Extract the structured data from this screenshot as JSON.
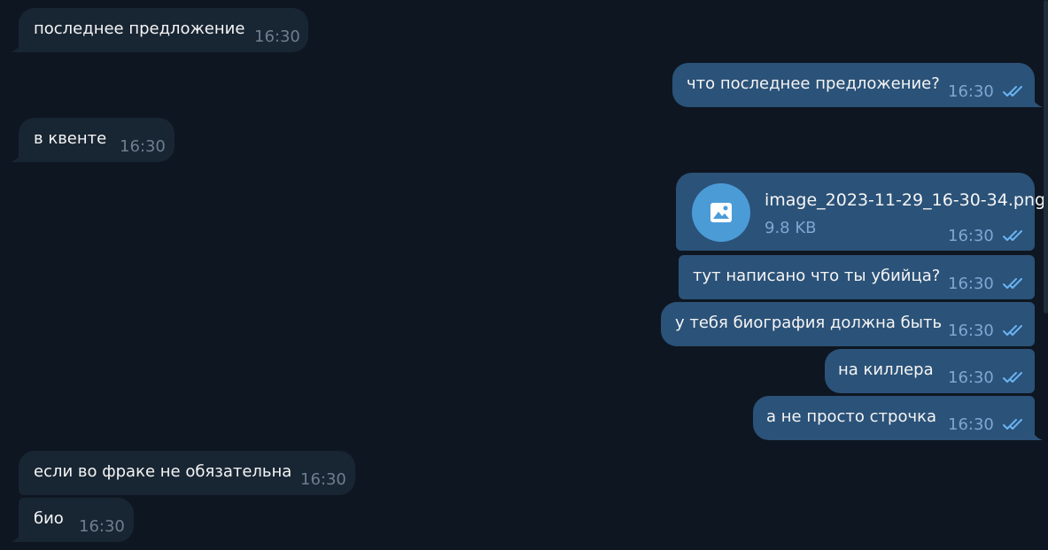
{
  "messages": [
    {
      "text": "последнее предложение",
      "time": "16:30"
    },
    {
      "text": "что последнее предложение?",
      "time": "16:30"
    },
    {
      "text": "в квенте",
      "time": "16:30"
    },
    {
      "file_name": "image_2023-11-29_16-30-34.png",
      "file_size": "9.8 KB",
      "time": "16:30",
      "icon": "image-icon"
    },
    {
      "text": "тут написано что ты убийца?",
      "time": "16:30"
    },
    {
      "text": "у тебя биография должна быть",
      "time": "16:30"
    },
    {
      "text": "на киллера",
      "time": "16:30"
    },
    {
      "text": "а не просто строчка",
      "time": "16:30"
    },
    {
      "text": "если во фраке не обязательна",
      "time": "16:30"
    },
    {
      "text": "био",
      "time": "16:30"
    }
  ],
  "colors": {
    "background": "#0e1621",
    "incoming_bubble": "#182533",
    "outgoing_bubble": "#2b5278",
    "check_marks": "#6ab3f3",
    "file_icon": "#4b9bd7"
  }
}
